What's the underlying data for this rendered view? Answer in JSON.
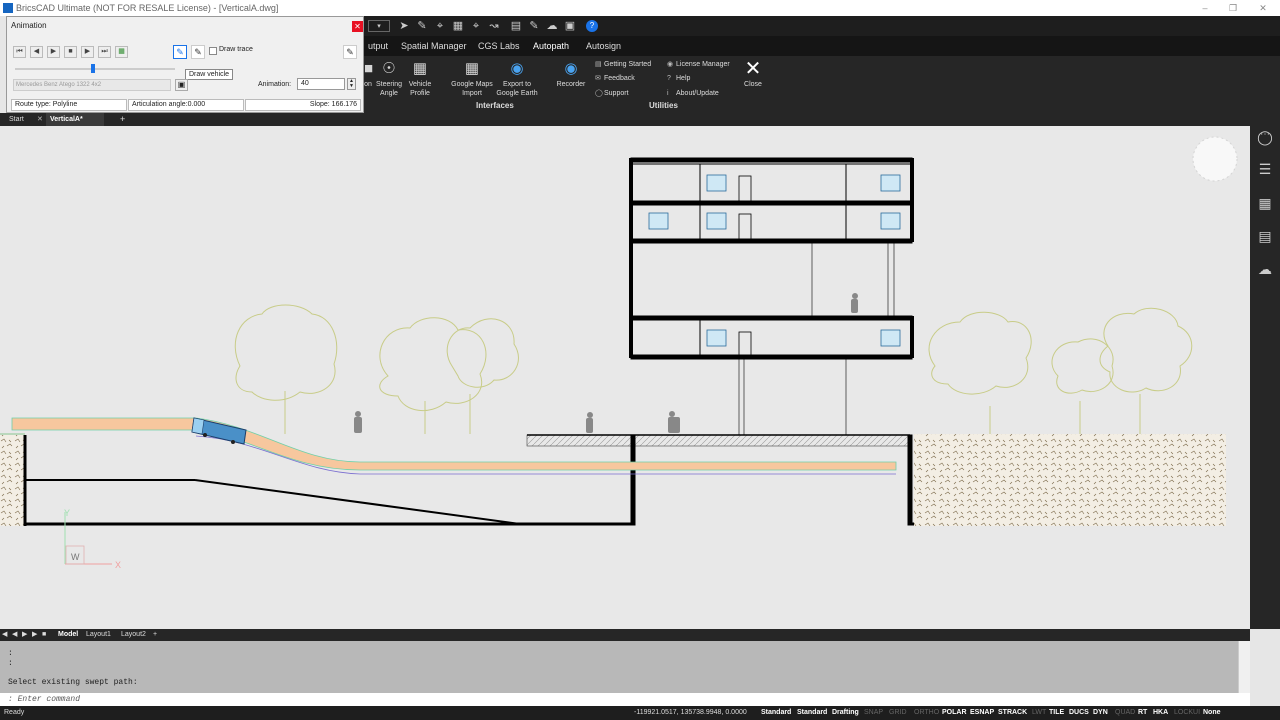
{
  "window": {
    "title": "BricsCAD Ultimate (NOT FOR RESALE License) - [VerticalA.dwg]"
  },
  "ribbon": {
    "tabs": [
      "utput",
      "Spatial Manager",
      "CGS Labs",
      "Autopath",
      "Autosign"
    ],
    "active_tab": "Autopath",
    "buttons": [
      {
        "label": "on",
        "icon": "truncated-icon"
      },
      {
        "label": "Steering\nAngle",
        "icon": "steering-wheel-icon"
      },
      {
        "label": "Vehicle\nProfile",
        "icon": "vehicle-profile-icon"
      },
      {
        "label": "Google Maps\nImport",
        "icon": "google-maps-icon"
      },
      {
        "label": "Export to\nGoogle Earth",
        "icon": "google-earth-icon"
      },
      {
        "label": "Recorder",
        "icon": "recorder-icon"
      }
    ],
    "utilities": [
      "Getting Started",
      "Feedback",
      "Support",
      "License Manager",
      "Help",
      "About/Update"
    ],
    "close_label": "Close",
    "groups": {
      "interfaces": "Interfaces",
      "utilities": "Utilities"
    }
  },
  "doc_tabs": {
    "start": "Start",
    "active": "VerticalA*",
    "add": "+"
  },
  "animation_dialog": {
    "title": "Animation",
    "draw_trace_label": "Draw trace",
    "tooltip": "Draw vehicle",
    "vehicle": "Mercedes Benz Atego 1322 4x2",
    "animation_label": "Animation:",
    "animation_value": "40",
    "route_type": "Route type: Polyline",
    "articulation": "Articulation angle:0.000",
    "slope": "Slope: 166.176"
  },
  "layout_tabs": {
    "model": "Model",
    "layout1": "Layout1",
    "layout2": "Layout2",
    "add": "+"
  },
  "command": {
    "history": [
      ":",
      ":",
      "Select existing swept path:"
    ],
    "prompt": ": Enter command"
  },
  "status": {
    "ready": "Ready",
    "coords": "-119921.0517, 135738.9948, 0.0000",
    "items": [
      {
        "t": "Standard",
        "on": true
      },
      {
        "t": "Standard",
        "on": true
      },
      {
        "t": "Drafting",
        "on": true
      },
      {
        "t": "SNAP",
        "on": false
      },
      {
        "t": "GRID",
        "on": false
      },
      {
        "t": "ORTHO",
        "on": false
      },
      {
        "t": "POLAR",
        "on": true
      },
      {
        "t": "ESNAP",
        "on": true
      },
      {
        "t": "STRACK",
        "on": true
      },
      {
        "t": "LWT",
        "on": false
      },
      {
        "t": "TILE",
        "on": true
      },
      {
        "t": "DUCS",
        "on": true
      },
      {
        "t": "DYN",
        "on": true
      },
      {
        "t": "QUAD",
        "on": false
      },
      {
        "t": "RT",
        "on": true
      },
      {
        "t": "HKA",
        "on": true
      },
      {
        "t": "LOCKUI",
        "on": false
      },
      {
        "t": "None",
        "on": true
      }
    ]
  },
  "ucs": {
    "y": "Y",
    "x": "X",
    "w": "W"
  },
  "colors": {
    "road": "#f5c7a0",
    "vehicle": "#4a90c8",
    "tree": "#c8cc88",
    "accent": "#1a73e8"
  }
}
